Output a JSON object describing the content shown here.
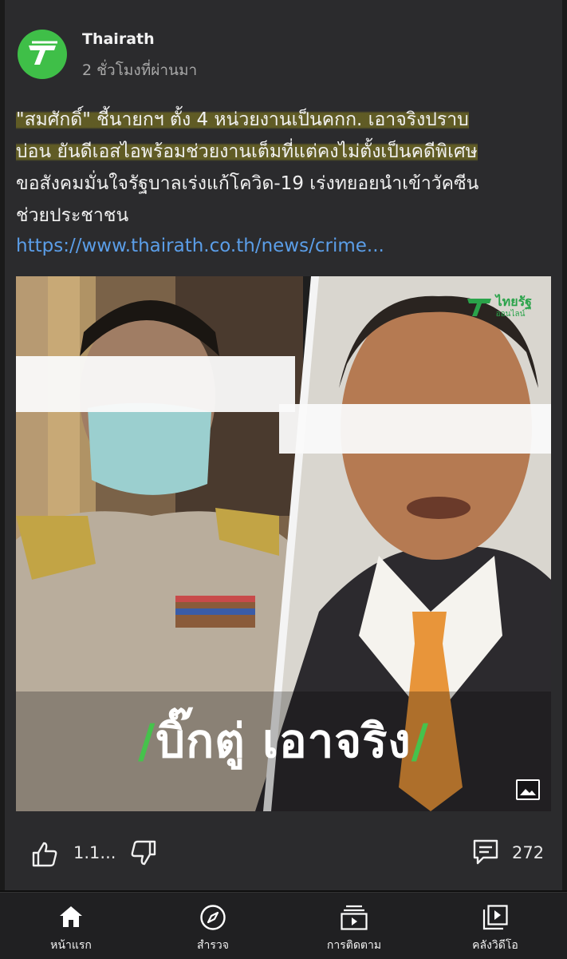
{
  "post": {
    "page_name": "Thairath",
    "time": "2 ชั่วโมงที่ผ่านมา",
    "text_line1": "\"สมศักดิ์\" ชี้นายกฯ ตั้ง 4 หน่วยงานเป็นคกก. เอาจริงปราบ",
    "text_line2": "บ่อน ยันดีเอสไอพร้อมช่วยงานเต็มที่แต่คงไม่ตั้งเป็นคดีพิเศษ",
    "text_line3": "ขอสังคมมั่นใจรัฐบาลเร่งแก้โควิด-19 เร่งทยอยนำเข้าวัคซีน",
    "text_line4": "ช่วยประชาชน",
    "link": "https://www.thairath.co.th/news/crime...",
    "image_caption": "บิ๊กตู่ เอาจริง",
    "caption_slash": "/",
    "watermark_main": "ไทยรัฐ",
    "watermark_sub": "ออนไลน์"
  },
  "actions": {
    "like_count": "1.1...",
    "comment_count": "272"
  },
  "nav": {
    "home": "หน้าแรก",
    "explore": "สำรวจ",
    "following": "การติดตาม",
    "video_library": "คลังวิดีโอ"
  },
  "colors": {
    "brand_green": "#3fbf48",
    "link_blue": "#5b9ee8",
    "highlight": "#746e22",
    "background": "#2b2b2d"
  },
  "icons": [
    "thairath-logo-icon",
    "gallery-icon",
    "thumbs-up-icon",
    "thumbs-down-icon",
    "comment-icon",
    "home-icon",
    "compass-icon",
    "subscriptions-icon",
    "video-library-icon"
  ]
}
